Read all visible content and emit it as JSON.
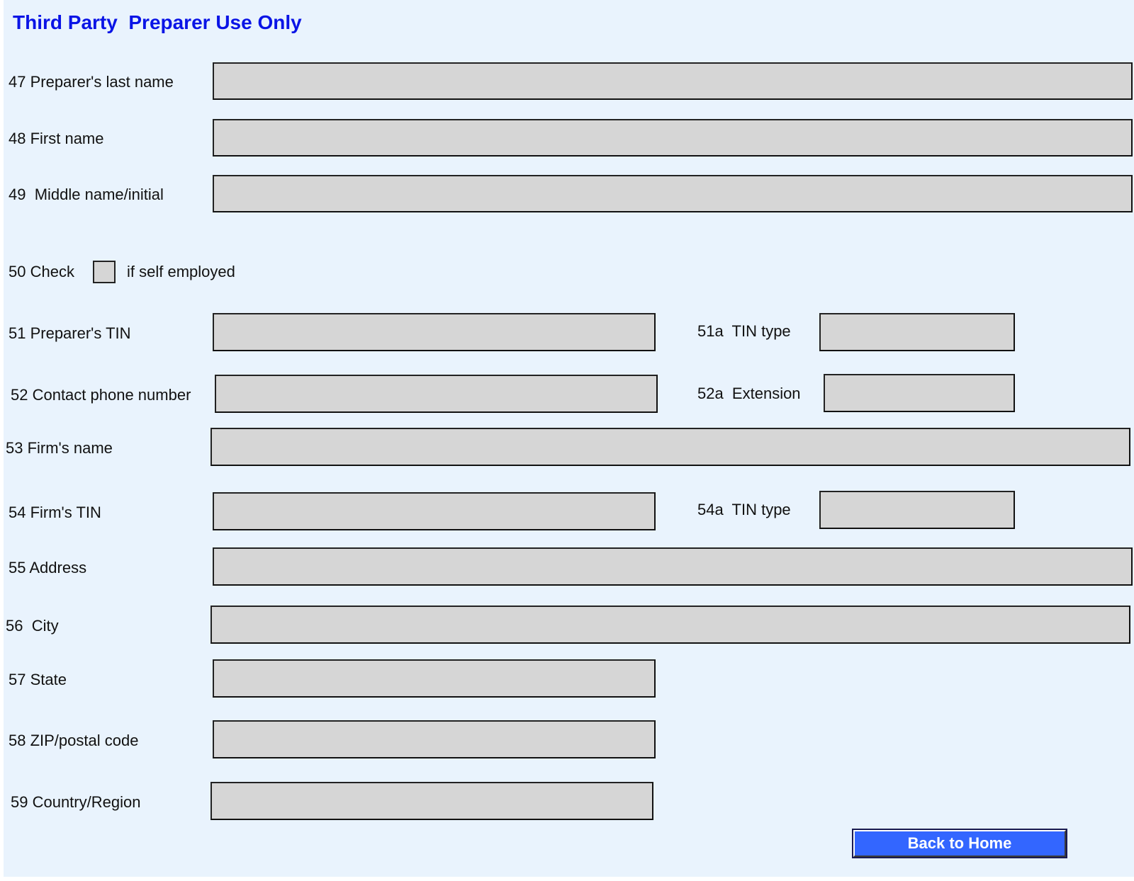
{
  "header": {
    "title": "Third Party  Preparer Use Only"
  },
  "fields": {
    "f47": {
      "label": "47 Preparer's last name",
      "value": ""
    },
    "f48": {
      "label": "48 First name",
      "value": ""
    },
    "f49": {
      "label": "49  Middle name/initial",
      "value": ""
    },
    "f50": {
      "label_before": "50 Check",
      "label_after": "if self employed",
      "checked": false
    },
    "f51": {
      "label": "51 Preparer's TIN",
      "value": ""
    },
    "f51a": {
      "label": "51a  TIN type",
      "value": ""
    },
    "f52": {
      "label": "52 Contact phone number",
      "value": ""
    },
    "f52a": {
      "label": "52a  Extension",
      "value": ""
    },
    "f53": {
      "label": "53 Firm's name",
      "value": ""
    },
    "f54": {
      "label": "54 Firm's TIN",
      "value": ""
    },
    "f54a": {
      "label": "54a  TIN type",
      "value": ""
    },
    "f55": {
      "label": "55 Address",
      "value": ""
    },
    "f56": {
      "label": "56  City",
      "value": ""
    },
    "f57": {
      "label": "57 State",
      "value": ""
    },
    "f58": {
      "label": "58 ZIP/postal code",
      "value": ""
    },
    "f59": {
      "label": "59 Country/Region",
      "value": ""
    }
  },
  "actions": {
    "back_to_home": "Back to Home"
  },
  "colors": {
    "title": "#0a14e6",
    "background": "#e9f3fd",
    "field": "#d6d6d6",
    "button": "#3366ff"
  }
}
